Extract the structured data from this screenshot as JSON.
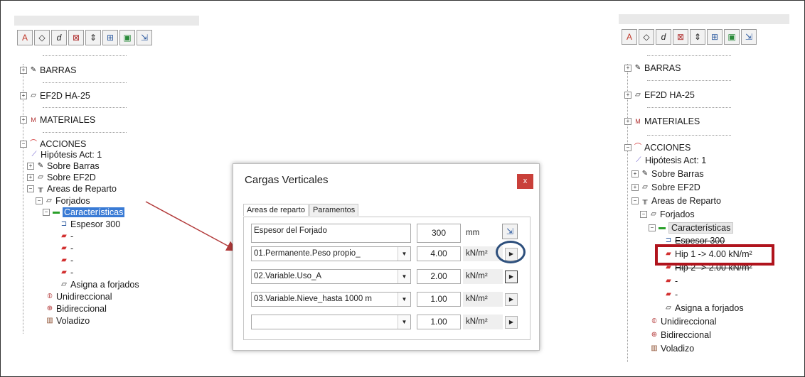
{
  "left_tree": {
    "toolbar_icons": [
      "settings-icon",
      "tag-icon",
      "copy-icon",
      "delete-icon",
      "sort-icon",
      "grid-icon",
      "image-icon",
      "export-icon"
    ],
    "items": {
      "barras": "BARRAS",
      "ef2d": "EF2D HA-25",
      "materiales": "MATERIALES",
      "acciones": "ACCIONES",
      "hipotesis": "Hipótesis Act: 1",
      "sobre_barras": "Sobre Barras",
      "sobre_ef2d": "Sobre EF2D",
      "areas_reparto": "Areas de Reparto",
      "forjados": "Forjados",
      "caracteristicas": "Características",
      "espesor": "Espesor 300",
      "dash1": "-",
      "dash2": "-",
      "dash3": "-",
      "dash4": "-",
      "asigna": "Asigna a forjados",
      "unidireccional": "Unidireccional",
      "bidireccional": "Bidireccional",
      "voladizo": "Voladizo"
    }
  },
  "dialog": {
    "title": "Cargas Verticales",
    "close": "x",
    "tabs": [
      "Areas de reparto",
      "Paramentos"
    ],
    "espesor_label": "Espesor del Forjado",
    "espesor_value": "300",
    "espesor_unit": "mm",
    "rows": [
      {
        "combo": "01.Permanente.Peso propio_",
        "value": "4.00",
        "unit": "kN/m²"
      },
      {
        "combo": "02.Variable.Uso_A",
        "value": "2.00",
        "unit": "kN/m²"
      },
      {
        "combo": "03.Variable.Nieve_hasta 1000 m",
        "value": "1.00",
        "unit": "kN/m²"
      },
      {
        "combo": "",
        "value": "1.00",
        "unit": "kN/m²"
      }
    ]
  },
  "right_tree": {
    "items": {
      "barras": "BARRAS",
      "ef2d": "EF2D HA-25",
      "materiales": "MATERIALES",
      "acciones": "ACCIONES",
      "hipotesis": "Hipótesis Act: 1",
      "sobre_barras": "Sobre Barras",
      "sobre_ef2d": "Sobre EF2D",
      "areas_reparto": "Areas de Reparto",
      "forjados": "Forjados",
      "caracteristicas": "Características",
      "espesor": "Espesor 300",
      "hip1": "Hip 1 -> 4.00 kN/m²",
      "hip2": "Hip 2 -> 2.00 kN/m²",
      "dash1": "-",
      "dash2": "-",
      "asigna": "Asigna a forjados",
      "unidireccional": "Unidireccional",
      "bidireccional": "Bidireccional",
      "voladizo": "Voladizo"
    }
  },
  "colors": {
    "selection": "#3a7bd5",
    "highlight_red": "#b0141d",
    "circle_blue": "#2d4f7c",
    "arrow": "#b23a3a"
  }
}
